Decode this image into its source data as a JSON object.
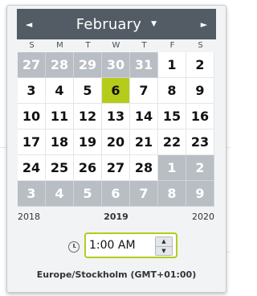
{
  "calendar": {
    "month": "February",
    "year_prev": "2018",
    "year_current": "2019",
    "year_next": "2020",
    "weekdays": [
      "S",
      "M",
      "T",
      "W",
      "T",
      "F",
      "S"
    ],
    "days": [
      {
        "label": "27",
        "state": "other"
      },
      {
        "label": "28",
        "state": "other"
      },
      {
        "label": "29",
        "state": "other"
      },
      {
        "label": "30",
        "state": "other"
      },
      {
        "label": "31",
        "state": "other"
      },
      {
        "label": "1",
        "state": "current"
      },
      {
        "label": "2",
        "state": "current"
      },
      {
        "label": "3",
        "state": "current"
      },
      {
        "label": "4",
        "state": "current"
      },
      {
        "label": "5",
        "state": "current"
      },
      {
        "label": "6",
        "state": "selected"
      },
      {
        "label": "7",
        "state": "current"
      },
      {
        "label": "8",
        "state": "current"
      },
      {
        "label": "9",
        "state": "current"
      },
      {
        "label": "10",
        "state": "current"
      },
      {
        "label": "11",
        "state": "current"
      },
      {
        "label": "12",
        "state": "current"
      },
      {
        "label": "13",
        "state": "current"
      },
      {
        "label": "14",
        "state": "current"
      },
      {
        "label": "15",
        "state": "current"
      },
      {
        "label": "16",
        "state": "current"
      },
      {
        "label": "17",
        "state": "current"
      },
      {
        "label": "18",
        "state": "current"
      },
      {
        "label": "19",
        "state": "current"
      },
      {
        "label": "20",
        "state": "current"
      },
      {
        "label": "21",
        "state": "current"
      },
      {
        "label": "22",
        "state": "current"
      },
      {
        "label": "23",
        "state": "current"
      },
      {
        "label": "24",
        "state": "current"
      },
      {
        "label": "25",
        "state": "current"
      },
      {
        "label": "26",
        "state": "current"
      },
      {
        "label": "27",
        "state": "current"
      },
      {
        "label": "28",
        "state": "current"
      },
      {
        "label": "1",
        "state": "other"
      },
      {
        "label": "2",
        "state": "other"
      },
      {
        "label": "3",
        "state": "other"
      },
      {
        "label": "4",
        "state": "other"
      },
      {
        "label": "5",
        "state": "other"
      },
      {
        "label": "6",
        "state": "other"
      },
      {
        "label": "7",
        "state": "other"
      },
      {
        "label": "8",
        "state": "other"
      },
      {
        "label": "9",
        "state": "other"
      }
    ]
  },
  "time": {
    "value": "1:00 AM",
    "icon": "clock-icon"
  },
  "timezone": "Europe/Stockholm (GMT+01:00)",
  "icons": {
    "prev": "◄",
    "next": "►",
    "month_dropdown": "▼",
    "step_up": "▲",
    "step_down": "▼"
  },
  "colors": {
    "header_bg": "#535c65",
    "selected_day": "#b5cc1a",
    "other_month_day": "#b8bec4",
    "input_focus_border": "#b5cc1a"
  }
}
